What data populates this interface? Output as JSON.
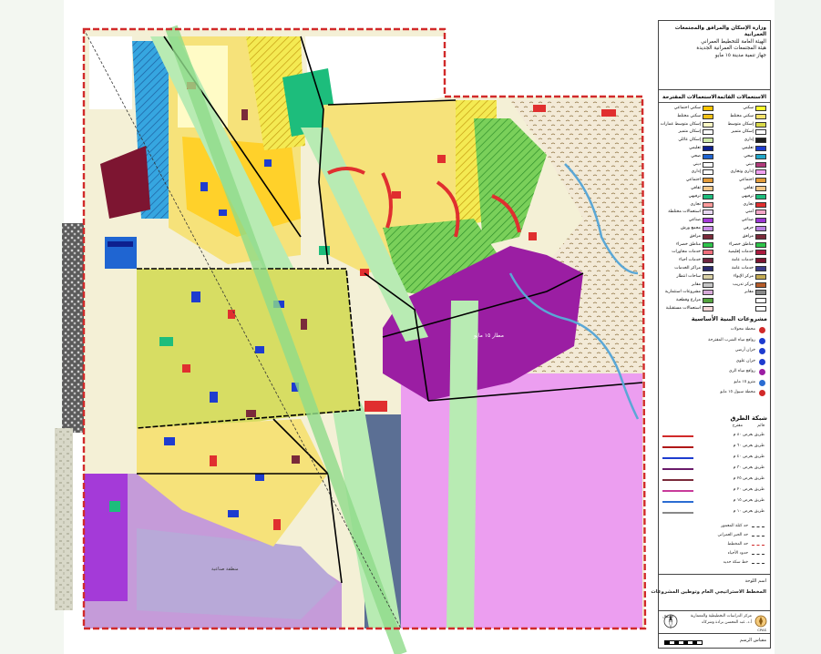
{
  "map": {
    "labels": {
      "airport_area": "مطار ١٥ مايو",
      "east_industrial": "منطقة صناعية",
      "north_label": "الشمال"
    },
    "colors": {
      "boundary": "#d12a2a",
      "residential": "#ffff2d",
      "green": "#2ec44b",
      "magenta": "#a01ea0",
      "lightpink": "#ec9ef0",
      "road": "#000000"
    }
  },
  "panel": {
    "title_lines": [
      "وزارة الإسكان والمرافق والمجتمعات العمرانية",
      "الهيئة العامة للتخطيط العمراني",
      "هيئة المجتمعات العمرانية الجديدة",
      "جهاز تنمية مدينة ١٥ مايو"
    ],
    "legend_headers": {
      "existing": "الاستعمالات القائمة",
      "proposed": "الاستعمالات المقترحة"
    },
    "legend_items": [
      {
        "label": "سكني",
        "label2": "سكني اجتماعي",
        "color": "#ffff2d",
        "color2": "#ffc400"
      },
      {
        "label": "سكني مختلط",
        "label2": "سكني مختلط",
        "color": "#f7e26b",
        "color2": "#f2c218"
      },
      {
        "label": "إسكان متوسط",
        "label2": "إسكان متوسط عمارات",
        "color": "#d9d94a",
        "color2": "#fffbc6"
      },
      {
        "label": "إسكان متميز",
        "label2": "إسكان متميز",
        "color": "#ffffff",
        "color2": "#ffffff"
      },
      {
        "label": "إداري",
        "label2": "إسكان عائلي",
        "color": "#1f1f1f",
        "color2": "#cde8a9"
      },
      {
        "label": "تعليمي",
        "label2": "تعليمي",
        "color": "#1e3ccf",
        "color2": "#0d1f8f"
      },
      {
        "label": "صحي",
        "label2": "صحي",
        "color": "#22a7c9",
        "color2": "#1f65d2"
      },
      {
        "label": "ديني",
        "label2": "ديني",
        "color": "#b03a7a",
        "color2": "#ffffff"
      },
      {
        "label": "إداري وتجاري",
        "label2": "إداري",
        "color": "#f0a0f0",
        "color2": "#ffffff"
      },
      {
        "label": "اجتماعي",
        "label2": "اجتماعي",
        "color": "#e39b3a",
        "color2": "#e39b3a"
      },
      {
        "label": "ثقافي",
        "label2": "ثقافي",
        "color": "#f4c88a",
        "color2": "#f4c88a"
      },
      {
        "label": "ترفيهي",
        "label2": "ترفيهي",
        "color": "#1dbd7c",
        "color2": "#1dbd7c"
      },
      {
        "label": "تجاري",
        "label2": "تجاري",
        "color": "#e02f2f",
        "color2": "#ff9a9a"
      },
      {
        "label": "أمني",
        "label2": "استعمالات مختلطة",
        "color": "#f4a6c8",
        "color2": "#e7d7f0"
      },
      {
        "label": "صناعي",
        "label2": "صناعي",
        "color": "#9b36d4",
        "color2": "#a43ad8"
      },
      {
        "label": "حرفي",
        "label2": "مجمع ورش",
        "color": "#b982e3",
        "color2": "#c98be8"
      },
      {
        "label": "مرافق",
        "label2": "مرافق",
        "color": "#7a2a3a",
        "color2": "#7a2a3a"
      },
      {
        "label": "مناطق خضراء",
        "label2": "مناطق خضراء",
        "color": "#2ec44b",
        "color2": "#2ec44b"
      },
      {
        "label": "خدمات إقليمية",
        "label2": "خدمات مجاورات",
        "color": "#ab1a3e",
        "color2": "#f06e7c"
      },
      {
        "label": "خدمات عامة",
        "label2": "خدمات أحياء",
        "color": "#7d1531",
        "color2": "#6f2640"
      },
      {
        "label": "خدمات عامة",
        "label2": "مراكز الخدمات",
        "color": "#3c3c8a",
        "color2": "#2b2b70"
      },
      {
        "label": "مركز الإيواء",
        "label2": "ساحات انتظار",
        "color": "#c3aa53",
        "color2": "#d9d1a6"
      },
      {
        "label": "مركز تدريب",
        "label2": "مقابر",
        "color": "#b55c2a",
        "color2": "#c6c6c6"
      },
      {
        "label": "مقابر",
        "label2": "مشروعات استثمارية",
        "color": "#8a8a8a",
        "color2": "#d7a9d8"
      },
      {
        "label": "",
        "label2": "مزارع وقطعية",
        "color": "#ffffff",
        "color2": "#56a33d"
      },
      {
        "label": "",
        "label2": "استعمالات مستقبلية",
        "color": "#ffffff",
        "color2": "#f7d8d8"
      }
    ],
    "infra_title": "مشروعات البنية الأساسية",
    "infra_items": [
      "محطة محولات",
      "روافع مياه الشرب المقترحة",
      "خزان أرضي",
      "خزان علوي",
      "روافع مياه الري",
      "مترو ١٥ مايو",
      "محطة سيول ١٥ مايو"
    ],
    "road_title": "شبكة الطرق",
    "road_header_existing": "قائم",
    "road_header_proposed": "مقترح",
    "road_items": [
      "طريق بعرض ٨٠ م",
      "طريق بعرض ٦٠ م",
      "طريق بعرض ٤٠ م",
      "طريق بعرض ٣٠ م",
      "طريق بعرض ٢٥ م",
      "طريق بعرض ٢٠ م",
      "طريق بعرض ١٥ م",
      "طريق بعرض ١٠ م"
    ],
    "boundary_items": [
      "حد كتلة المعمور",
      "حد الحيز العمراني",
      "حد المخطط",
      "حدود الأحياء",
      "خط سكة حديد"
    ],
    "map_name_label": "اسم اللوحة",
    "map_name": "المخطط الاستراتيجي العام وتوطين المشروعات",
    "org_name": "مركز الدراسات التخطيطية والمعمارية",
    "org_sub": "أ.د. عبد المحسن برادة وشركاه",
    "org_short": "CPAS",
    "scale_label": "مقياس الرسم"
  }
}
